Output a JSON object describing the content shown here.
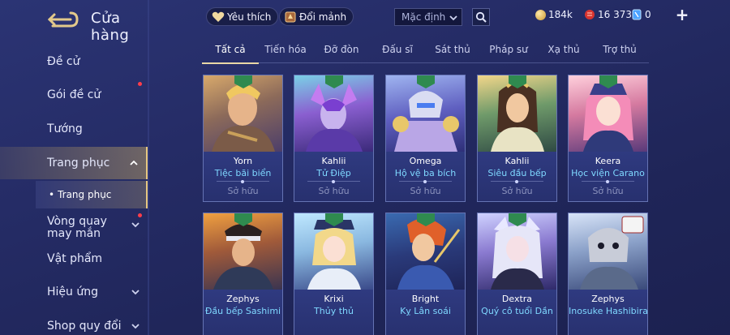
{
  "header": {
    "title": "Cửa hàng"
  },
  "sidebar": {
    "items": [
      {
        "label": "Đề cử"
      },
      {
        "label": "Gói đề cử"
      },
      {
        "label": "Tướng"
      },
      {
        "label": "Trang phục"
      },
      {
        "label": "Vòng quay may mắn"
      },
      {
        "label": "Vật phẩm"
      },
      {
        "label": "Hiệu ứng"
      },
      {
        "label": "Shop quy đổi"
      }
    ],
    "sub_item": "Trang phục"
  },
  "topbar": {
    "favorites_label": "Yêu thích",
    "exchange_label": "Đổi mảnh",
    "sort_value": "Mặc định",
    "currency_gold": "184k",
    "currency_red": "16 373",
    "currency_voucher": "0"
  },
  "tabs": [
    {
      "label": "Tất cả"
    },
    {
      "label": "Tiến hóa"
    },
    {
      "label": "Đỡ đòn"
    },
    {
      "label": "Đấu sĩ"
    },
    {
      "label": "Sát thủ"
    },
    {
      "label": "Pháp sư"
    },
    {
      "label": "Xạ thủ"
    },
    {
      "label": "Trợ thủ"
    }
  ],
  "cards": [
    {
      "hero": "Yorn",
      "skin": "Tiệc bãi biển",
      "status": "Sở hữu",
      "rank": "A"
    },
    {
      "hero": "Kahlii",
      "skin": "Tử Điệp",
      "status": "Sở hữu",
      "rank": "A"
    },
    {
      "hero": "Omega",
      "skin": "Hộ vệ ba bích",
      "status": "Sở hữu",
      "rank": "A"
    },
    {
      "hero": "Kahlii",
      "skin": "Siêu đầu bếp",
      "status": "Sở hữu",
      "rank": "A"
    },
    {
      "hero": "Keera",
      "skin": "Học viện Carano",
      "status": "Sở hữu",
      "rank": "A"
    },
    {
      "hero": "Zephys",
      "skin": "Đầu bếp Sashimi",
      "status": "",
      "rank": "A"
    },
    {
      "hero": "Krixi",
      "skin": "Thủy thủ",
      "status": "",
      "rank": "A"
    },
    {
      "hero": "Bright",
      "skin": "Kỵ Lân soái",
      "status": "",
      "rank": "A"
    },
    {
      "hero": "Dextra",
      "skin": "Quý cô tuổi Dần",
      "status": "",
      "rank": "A"
    },
    {
      "hero": "Zephys",
      "skin": "Inosuke Hashibira",
      "status": "",
      "rank": ""
    }
  ],
  "colors": {
    "accent_gold": "#e9d7a6",
    "skin_name": "#7fd8ff",
    "notify_red": "#ff3d4a"
  }
}
